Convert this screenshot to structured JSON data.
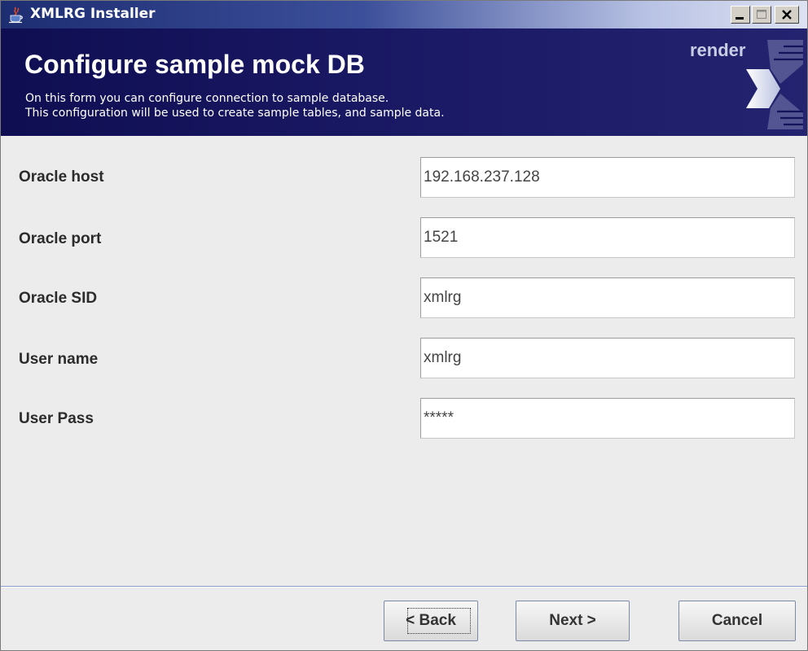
{
  "window": {
    "title": "XMLRG Installer",
    "icons": {
      "app": "java-cup-icon",
      "minimize": "minimize-icon",
      "maximize": "maximize-icon",
      "close": "close-icon"
    }
  },
  "header": {
    "title": "Configure sample mock DB",
    "description_line1": "On this form you can configure connection to sample database.",
    "description_line2": "This configuration will be used to create sample tables, and sample data.",
    "logo_text": "render",
    "colors": {
      "banner_background": "#14135C",
      "text": "#FFFFFF"
    }
  },
  "form": {
    "fields": [
      {
        "label": "Oracle host",
        "value": "192.168.237.128"
      },
      {
        "label": "Oracle port",
        "value": "1521"
      },
      {
        "label": "Oracle SID",
        "value": "xmlrg"
      },
      {
        "label": "User name",
        "value": "xmlrg"
      },
      {
        "label": "User Pass",
        "value": "*****"
      }
    ]
  },
  "buttons": {
    "back": "< Back",
    "next": "Next >",
    "cancel": "Cancel"
  }
}
